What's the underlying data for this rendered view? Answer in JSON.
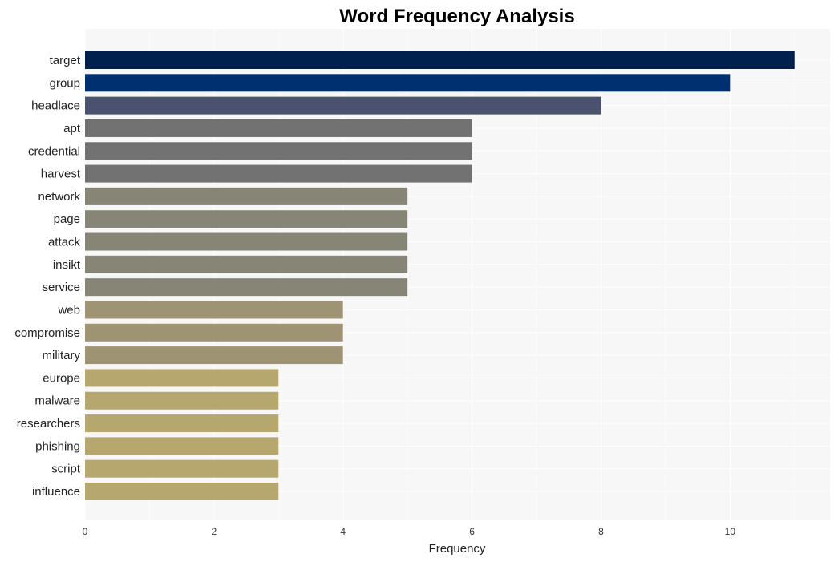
{
  "chart_data": {
    "type": "bar",
    "orientation": "horizontal",
    "title": "Word Frequency Analysis",
    "xlabel": "Frequency",
    "ylabel": "",
    "xlim": [
      0,
      11.55
    ],
    "xticks": [
      0,
      2,
      4,
      6,
      8,
      10
    ],
    "grid": true,
    "legend": "none",
    "categories": [
      "target",
      "group",
      "headlace",
      "apt",
      "credential",
      "harvest",
      "network",
      "page",
      "attack",
      "insikt",
      "service",
      "web",
      "compromise",
      "military",
      "europe",
      "malware",
      "researchers",
      "phishing",
      "script",
      "influence"
    ],
    "values": [
      11,
      10,
      8,
      6,
      6,
      6,
      5,
      5,
      5,
      5,
      5,
      4,
      4,
      4,
      3,
      3,
      3,
      3,
      3,
      3
    ],
    "colors": [
      "#00204e",
      "#00306f",
      "#4a5270",
      "#727273",
      "#727273",
      "#727273",
      "#878676",
      "#878676",
      "#878676",
      "#878676",
      "#878676",
      "#9e9473",
      "#9e9473",
      "#9e9473",
      "#b6a76f",
      "#b6a76f",
      "#b6a76f",
      "#b6a76f",
      "#b6a76f",
      "#b6a76f"
    ],
    "background": "#f7f7f7",
    "grid_color": "#ffffff"
  }
}
